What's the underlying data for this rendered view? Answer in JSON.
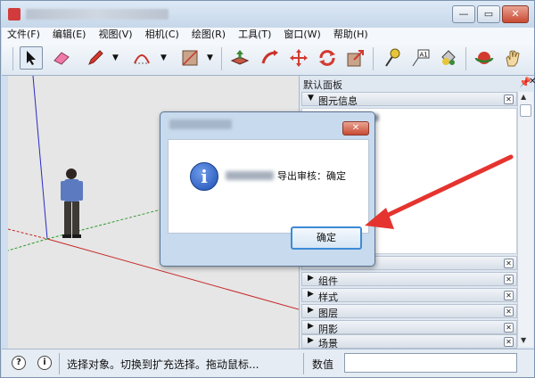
{
  "menubar": [
    {
      "label": "文件(F)"
    },
    {
      "label": "编辑(E)"
    },
    {
      "label": "视图(V)"
    },
    {
      "label": "相机(C)"
    },
    {
      "label": "绘图(R)"
    },
    {
      "label": "工具(T)"
    },
    {
      "label": "窗口(W)"
    },
    {
      "label": "帮助(H)"
    }
  ],
  "window_controls": {
    "minimize": "—",
    "maximize": "▭",
    "close": "✕"
  },
  "panel": {
    "title": "默认面板",
    "pin_icon": "📌",
    "close_icon": "✕",
    "trays_top": [
      {
        "label": "图元信息",
        "expanded": true
      }
    ],
    "trays_bottom": [
      {
        "label": "组件",
        "expanded": false
      },
      {
        "label": "样式",
        "expanded": false
      },
      {
        "label": "图层",
        "expanded": false
      },
      {
        "label": "阴影",
        "expanded": false
      },
      {
        "label": "场景",
        "expanded": false
      }
    ]
  },
  "dialog": {
    "message": "导出审核：确定",
    "ok_label": "确定",
    "close_icon": "✕",
    "info_glyph": "i"
  },
  "statusbar": {
    "hint_text": "选择对象。切换到扩充选择。拖动鼠标...",
    "measurement_label": "数值",
    "measurement_value": ""
  },
  "colors": {
    "annotation_arrow": "#e5342f",
    "accent_button": "#3c8bd5"
  }
}
